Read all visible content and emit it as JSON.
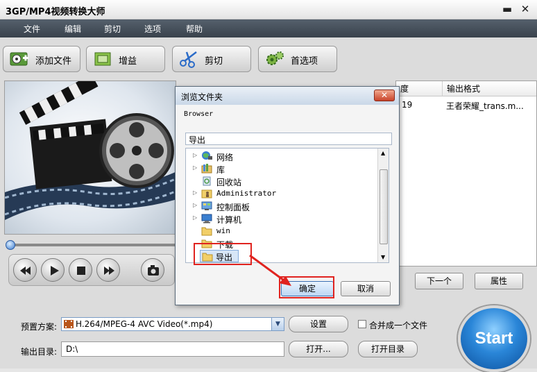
{
  "window": {
    "title": "3GP/MP4视频转换大师",
    "minimize_glyph": "▬",
    "close_glyph": "✕"
  },
  "menu": [
    "文件",
    "编辑",
    "剪切",
    "选项",
    "帮助"
  ],
  "toolbar": [
    {
      "label": "添加文件",
      "icon": "film-add-icon"
    },
    {
      "label": "增益",
      "icon": "gain-icon"
    },
    {
      "label": "剪切",
      "icon": "scissors-icon"
    },
    {
      "label": "首选项",
      "icon": "gears-icon"
    }
  ],
  "filelist": {
    "columns": [
      "度",
      "输出格式"
    ],
    "rows": [
      {
        "duration": "19",
        "format": "王者荣耀_trans.m..."
      }
    ]
  },
  "list_buttons": {
    "next": "下一个",
    "properties": "属性"
  },
  "bottom": {
    "preset_label": "预置方案:",
    "preset_value": "H.264/MPEG-4 AVC Video(*.mp4)",
    "settings_button": "设置",
    "merge_checkbox": "合并成一个文件",
    "output_label": "输出目录:",
    "output_value": "D:\\",
    "open_button": "打开...",
    "open_dir_button": "打开目录",
    "start_button": "Start"
  },
  "dialog": {
    "title": "浏览文件夹",
    "close_glyph": "✕",
    "prompt": "Browser",
    "path_value": "导出",
    "tree": [
      {
        "label": "网络",
        "icon": "network-icon",
        "expandable": true
      },
      {
        "label": "库",
        "icon": "library-icon",
        "expandable": true
      },
      {
        "label": "回收站",
        "icon": "recycle-bin-icon",
        "expandable": false
      },
      {
        "label": "Administrator",
        "icon": "user-folder-icon",
        "expandable": true
      },
      {
        "label": "控制面板",
        "icon": "control-panel-icon",
        "expandable": true
      },
      {
        "label": "计算机",
        "icon": "computer-icon",
        "expandable": true
      },
      {
        "label": "win",
        "icon": "folder-icon",
        "expandable": false
      },
      {
        "label": "下载",
        "icon": "folder-icon",
        "expandable": false
      },
      {
        "label": "导出",
        "icon": "folder-icon",
        "expandable": false,
        "selected": true
      }
    ],
    "ok_button": "确定",
    "cancel_button": "取消"
  },
  "colors": {
    "annotation_red": "#e0231f",
    "menubar": "#3f4852",
    "start_blue": "#2a86d8"
  }
}
